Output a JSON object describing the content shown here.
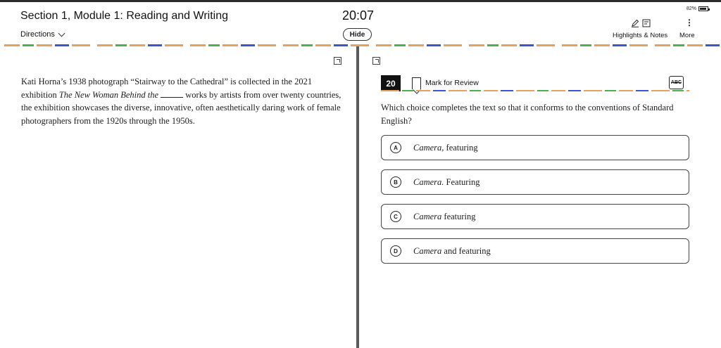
{
  "header": {
    "section_title": "Section 1, Module 1: Reading and Writing",
    "directions_label": "Directions",
    "timer": "20:07",
    "hide_label": "Hide",
    "battery": "82%",
    "highlights_label": "Highlights & Notes",
    "more_label": "More",
    "more_icon": "⋮"
  },
  "passage": {
    "text_1": "Kati Horna’s 1938 photograph “Stairway to the Cathedral” is collected in the 2021 exhibition ",
    "title": "The New Woman Behind the",
    "text_2": " works by artists from over twenty countries, the exhibition showcases the diverse, innovative, often aesthetically daring work of female photographers from the 1920s through the 1950s."
  },
  "question": {
    "number": "20",
    "mark_label": "Mark for Review",
    "abc_label": "ABC",
    "prompt": "Which choice completes the text so that it conforms to the conventions of Standard English?",
    "options": [
      {
        "letter": "A",
        "italic": "Camera,",
        "rest": " featuring"
      },
      {
        "letter": "B",
        "italic": "Camera.",
        "rest": " Featuring"
      },
      {
        "letter": "C",
        "italic": "Camera",
        "rest": " featuring"
      },
      {
        "letter": "D",
        "italic": "Camera",
        "rest": " and featuring"
      }
    ]
  },
  "colors": {
    "accent_orange": "#e7a15e",
    "accent_green": "#4caf50",
    "accent_blue": "#3d55c7",
    "divider": "#5a5a5a"
  },
  "icons": [
    "pen-icon",
    "note-icon",
    "battery-icon",
    "more-icon",
    "expand-icon",
    "collapse-icon",
    "bookmark-icon",
    "abc-eliminator-icon",
    "chevron-down-icon"
  ]
}
